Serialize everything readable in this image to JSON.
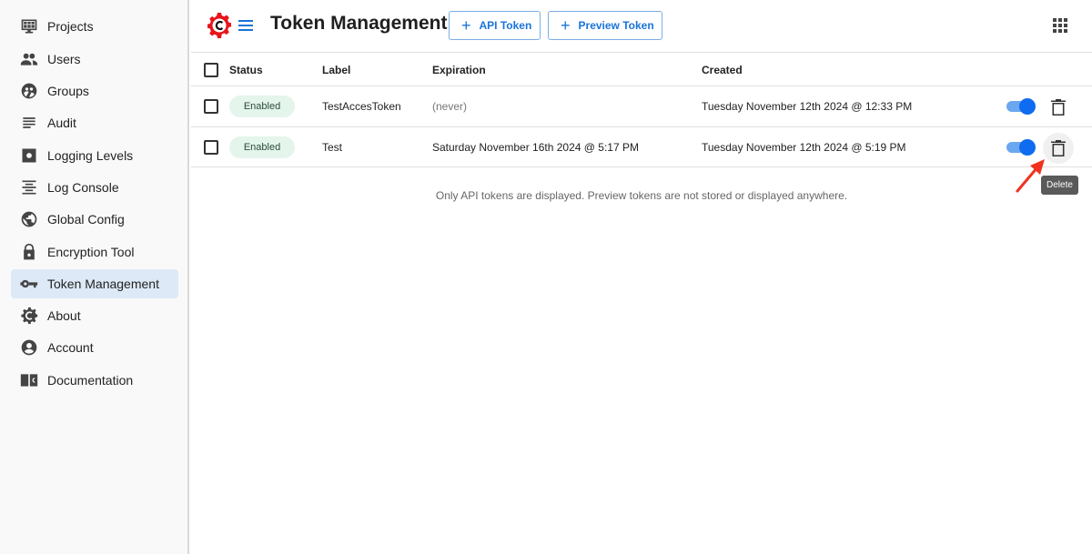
{
  "sidebar": {
    "items": [
      {
        "label": "Projects",
        "icon": "projects-monitor-icon",
        "active": false
      },
      {
        "label": "Users",
        "icon": "users-icon",
        "active": false
      },
      {
        "label": "Groups",
        "icon": "groups-icon",
        "active": false
      },
      {
        "label": "Audit",
        "icon": "audit-lines-icon",
        "active": false
      },
      {
        "label": "Logging Levels",
        "icon": "settings-box-icon",
        "active": false
      },
      {
        "label": "Log Console",
        "icon": "log-console-icon",
        "active": false
      },
      {
        "label": "Global Config",
        "icon": "globe-icon",
        "active": false
      },
      {
        "label": "Encryption Tool",
        "icon": "lock-icon",
        "active": false
      },
      {
        "label": "Token Management",
        "icon": "key-icon",
        "active": true
      },
      {
        "label": "About",
        "icon": "gear-c-logo-icon",
        "active": false
      },
      {
        "label": "Account",
        "icon": "account-circle-icon",
        "active": false
      },
      {
        "label": "Documentation",
        "icon": "book-icon",
        "active": false
      }
    ]
  },
  "header": {
    "title": "Token Management",
    "api_token_button": "API Token",
    "preview_token_button": "Preview Token",
    "plus_glyph": "+"
  },
  "table": {
    "columns": {
      "status": "Status",
      "label": "Label",
      "expiration": "Expiration",
      "created": "Created"
    },
    "rows": [
      {
        "status": "Enabled",
        "label": "TestAccesToken",
        "expiration": "(never)",
        "created": "Tuesday November 12th 2024 @ 12:33 PM",
        "enabled": true
      },
      {
        "status": "Enabled",
        "label": "Test",
        "expiration": "Saturday November 16th 2024 @ 5:17 PM",
        "created": "Tuesday November 12th 2024 @ 5:19 PM",
        "enabled": true
      }
    ]
  },
  "note": "Only API tokens are displayed. Preview tokens are not stored or displayed anywhere.",
  "tooltip": "Delete",
  "colors": {
    "accent": "#1a73d9",
    "toggle_on": "#0f6cf0",
    "badge_bg": "#e4f5ec",
    "logo_red": "#e8141b",
    "active_nav_bg": "#dde9f7",
    "annotation_arrow": "#f0321e"
  }
}
